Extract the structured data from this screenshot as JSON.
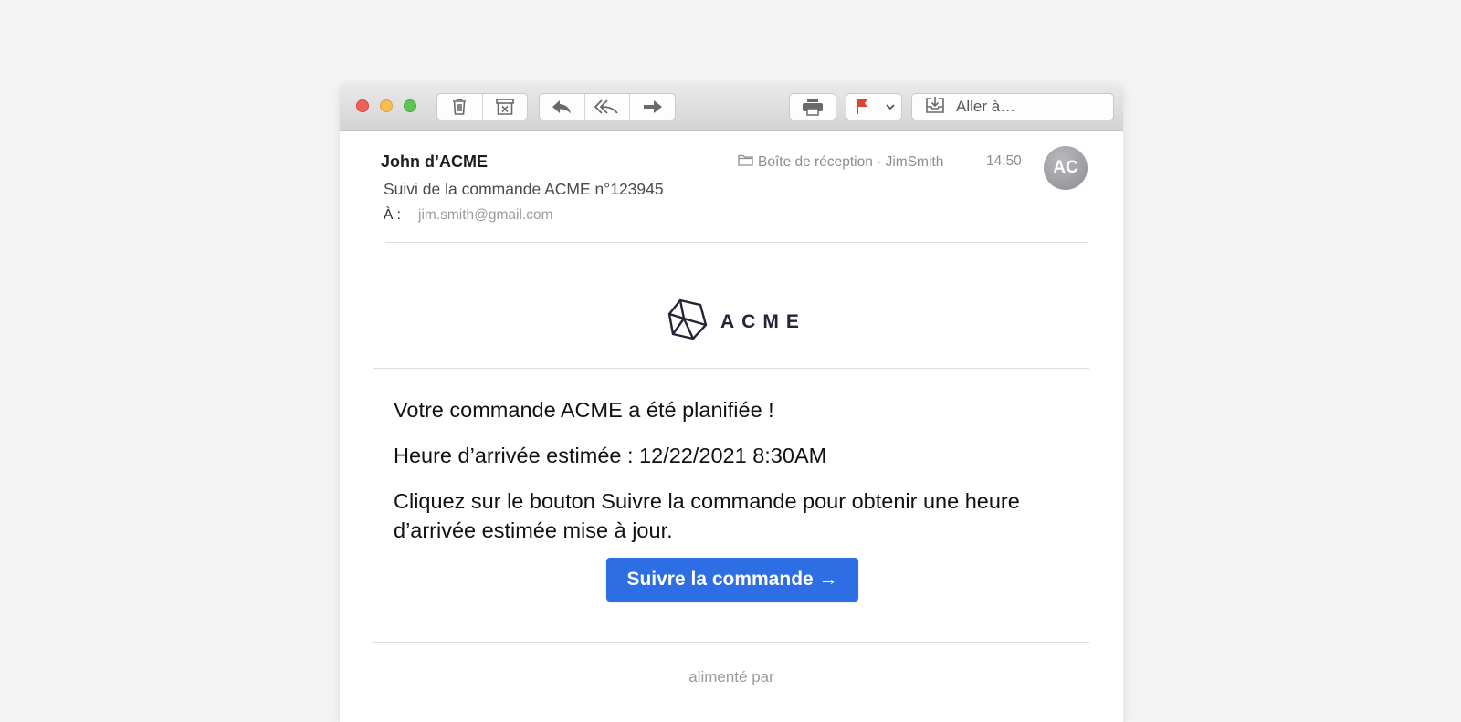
{
  "toolbar": {
    "icons": [
      "trash-icon",
      "archive-icon",
      "reply-icon",
      "reply-all-icon",
      "forward-icon",
      "print-icon",
      "flag-icon",
      "chevron-down-icon",
      "move-to-icon"
    ],
    "goto_label": "Aller à…",
    "flag_color": "#e0442f"
  },
  "message": {
    "sender": "John d’ACME",
    "subject": "Suivi de la commande ACME n°123945",
    "to_label": "À :",
    "to_value": "jim.smith@gmail.com",
    "mailbox": "Boîte de réception - JimSmith",
    "time": "14:50",
    "avatar_initials": "AC"
  },
  "email": {
    "brand": "ACME",
    "line1": "Votre commande ACME a été planifiée !",
    "line2": "Heure d’arrivée estimée : 12/22/2021 8:30AM",
    "line3": "Cliquez sur le bouton Suivre la commande pour obtenir une heure d’arrivée estimée mise à jour.",
    "button_label": "Suivre la commande →",
    "button_color": "#2e6ee4",
    "footer": "alimenté par"
  }
}
